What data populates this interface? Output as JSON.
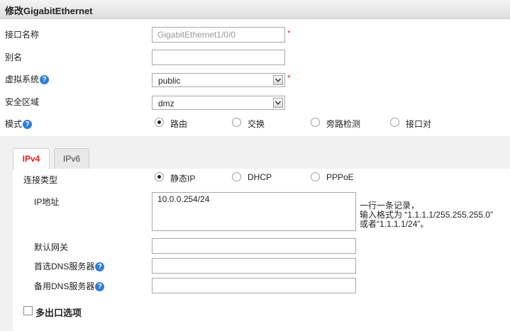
{
  "title": "修改GigabitEthernet",
  "form": {
    "interface_name_label": "接口名称",
    "interface_name_value": "GigabitEthernet1/0/0",
    "alias_label": "别名",
    "alias_value": "",
    "vsys_label": "虚拟系统",
    "vsys_value": "public",
    "zone_label": "安全区域",
    "zone_value": "dmz",
    "mode_label": "模式",
    "mode_options": [
      "路由",
      "交换",
      "旁路检测",
      "接口对"
    ],
    "mode_selected": "路由",
    "required_mark": "*",
    "help_glyph": "?"
  },
  "tabs": [
    {
      "label": "IPv4",
      "active": true
    },
    {
      "label": "IPv6",
      "active": false
    }
  ],
  "ipv4": {
    "conn_type_label": "连接类型",
    "conn_type_options": [
      "静态IP",
      "DHCP",
      "PPPoE"
    ],
    "conn_type_selected": "静态IP",
    "ip_label": "IP地址",
    "ip_value": "10.0.0.254/24",
    "ip_hint": [
      "一行一条记录，",
      "输入格式为 “1.1.1.1/255.255.255.0”",
      "或者“1.1.1.1/24”。"
    ],
    "gateway_label": "默认网关",
    "gateway_value": "",
    "dns1_label": "首选DNS服务器",
    "dns1_value": "",
    "dns2_label": "备用DNS服务器",
    "dns2_value": "",
    "multi_egress_label": "多出口选项",
    "multi_egress_checked": false
  },
  "colors": {
    "accent_red": "#d22222",
    "help_blue": "#2f7ed8"
  }
}
